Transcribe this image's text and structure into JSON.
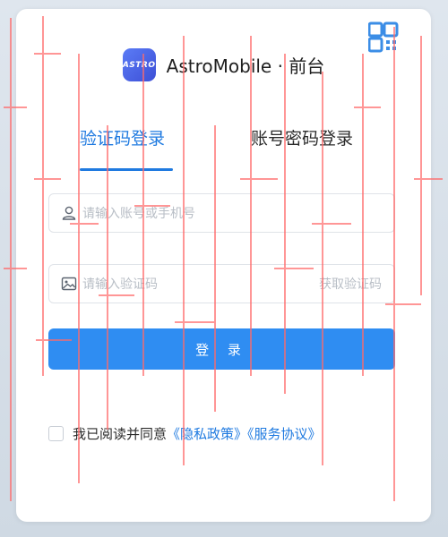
{
  "brand": {
    "logo_text": "ASTRO",
    "title": "AstroMobile · 前台"
  },
  "tabs": [
    {
      "label": "验证码登录",
      "active": true
    },
    {
      "label": "账号密码登录",
      "active": false
    }
  ],
  "form": {
    "account_placeholder": "请输入账号或手机号",
    "code_placeholder": "请输入验证码",
    "get_code_label": "获取验证码",
    "login_label": "登 录"
  },
  "agreement": {
    "prefix": "我已阅读并同意",
    "privacy_link": "《隐私政策》",
    "service_link": "《服务协议》",
    "checked": false
  },
  "icons": {
    "qr": "qr-code-icon",
    "user": "user-icon",
    "image": "image-icon"
  },
  "colors": {
    "accent": "#1f7ae0",
    "button": "#2f8df2",
    "watermark": "#ff6a6a"
  }
}
